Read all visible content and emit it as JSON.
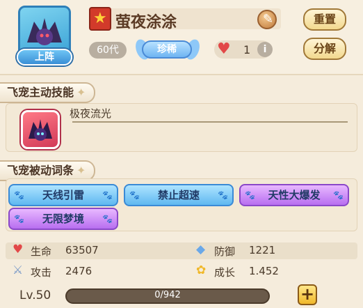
{
  "pet": {
    "name": "萤夜涂涂",
    "generation": "60代",
    "rarity": "珍稀",
    "hearts": "1"
  },
  "buttons": {
    "deploy": "上阵",
    "reset": "重置",
    "decompose": "分解"
  },
  "sections": {
    "active_skill": "飞宠主动技能",
    "passive_traits": "飞宠被动词条"
  },
  "active_skill": {
    "name": "极夜流光"
  },
  "traits": [
    {
      "label": "天线引雷",
      "style": "blue"
    },
    {
      "label": "禁止超速",
      "style": "blue"
    },
    {
      "label": "天性大爆发",
      "style": "purple"
    },
    {
      "label": "无限梦境",
      "style": "purple"
    }
  ],
  "stats": {
    "hp": {
      "label": "生命",
      "value": "63507",
      "icon": "heart-icon"
    },
    "defense": {
      "label": "防御",
      "value": "1221",
      "icon": "shield-crystal-icon"
    },
    "attack": {
      "label": "攻击",
      "value": "2476",
      "icon": "sword-icon"
    },
    "growth": {
      "label": "成长",
      "value": "1.452",
      "icon": "flower-icon"
    }
  },
  "level": {
    "label": "Lv.50",
    "exp_text": "0/942",
    "exp_fraction": 0
  },
  "colors": {
    "background": "#f5ecdc",
    "trait_blue": "#5fb8f0",
    "trait_purple": "#b86ef0",
    "button_gold": "#f2d98e"
  }
}
